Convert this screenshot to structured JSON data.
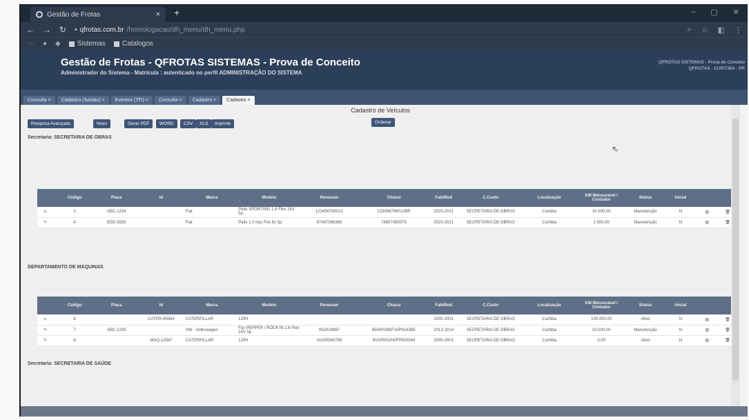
{
  "browser": {
    "tab_title": "Gestão de Frotas",
    "new_tab": "+",
    "url_host": "qfrotas.com.br",
    "url_path": "/homologacao/dh_menu/dh_menu.php",
    "bookmarks": [
      "Sistemas",
      "Catalogos"
    ]
  },
  "app": {
    "title": "Gestão de Frotas - QFROTAS SISTEMAS - Prova de Conceito",
    "subtitle": "Administrador do Sistema - Matrícula : autenticado no perfil ADMINISTRAÇÃO DO SISTEMA",
    "right_line1": "QFROTAS SISTEMAS - Prova de Conceito",
    "right_line2": "QFROTAS - CURITIBA - PR"
  },
  "tabs": [
    "Consulta",
    "Cadastro (Saídas)",
    "Eventos (TFI)",
    "Consulta",
    "Cadastro",
    "Cadastro"
  ],
  "page": {
    "title": "Cadastro de Veículos",
    "buttons": {
      "advanced_search": "Pesquisa Avançada",
      "new": "Novo",
      "pdf": "Gerar PDF",
      "word": "WORD",
      "csv": "CSV",
      "xls": "XLS",
      "print": "Imprimir",
      "sort": "Ordenar"
    }
  },
  "sections": {
    "obras": "Secretaria: SECRETARIA DE OBRAS",
    "maquinas": "DEPARTAMENTO DE MÁQUINAS",
    "saude": "Secretaria: SECRETARIA DE SAÚDE"
  },
  "table_headers": [
    "Código",
    "Placa",
    "Id",
    "Marca",
    "Modelo",
    "Renavam",
    "Chassi",
    "Fab/Mod",
    "C.Custo",
    "Localização",
    "KM Mensurável / Contador",
    "Status",
    "Inicial"
  ],
  "obras_rows": [
    {
      "codigo": "1",
      "placa": "ABC-1234",
      "id": "",
      "marca": "Fiat",
      "modelo": "Palio SPORTING 1.6 Flex 16V 5p",
      "renavam": "123456789012",
      "chassi": "123456789012BR",
      "fab": "2020-2021",
      "ccusto": "SECRETARIA DE OBRAS",
      "local": "Curitiba",
      "km": "10.000,00",
      "status": "Manutenção",
      "inicial": "N"
    },
    {
      "codigo": "4",
      "placa": "EEE-5555",
      "id": "",
      "marca": "Fiat",
      "modelo": "Palio 1.0 mpi Fire 8v 5p",
      "renavam": "87487566365",
      "chassi": "74857485075",
      "fab": "2020-2021",
      "ccusto": "SECRETARIA DE OBRAS",
      "local": "Curitiba",
      "km": "2.500,00",
      "status": "Manutenção",
      "inicial": "N"
    }
  ],
  "maquinas_rows": [
    {
      "codigo": "8",
      "placa": "",
      "id": "CATER-95564",
      "marca": "CATERPILLAR",
      "modelo": "120H",
      "renavam": "",
      "chassi": "",
      "fab": "2000-2001",
      "ccusto": "SECRETARIA DE OBRAS",
      "local": "Curitiba",
      "km": "100.000,00",
      "status": "Ativo",
      "inicial": "N"
    },
    {
      "codigo": "7",
      "placa": "ABC-1235",
      "id": "",
      "marca": "VW - Volkswagen",
      "modelo": "Fox PEPPER / ROCK'IN 1.6 Flex 16V 5p",
      "renavam": "952024987",
      "chassi": "85HP0285F16P61438E",
      "fab": "2013-2014",
      "ccusto": "SECRETARIA DE OBRAS",
      "local": "Curitiba",
      "km": "10.000,00",
      "status": "Manutenção",
      "inicial": "N"
    },
    {
      "codigo": "6",
      "placa": "",
      "id": "MAQ-12567",
      "marca": "CATERPILLAR",
      "modelo": "120H",
      "renavam": "01000540789",
      "chassi": "9VGR052H0FP800564",
      "fab": "2000-2001",
      "ccusto": "SECRETARIA DE OBRAS",
      "local": "Curitiba",
      "km": "0,00",
      "status": "Ativo",
      "inicial": "N"
    }
  ]
}
